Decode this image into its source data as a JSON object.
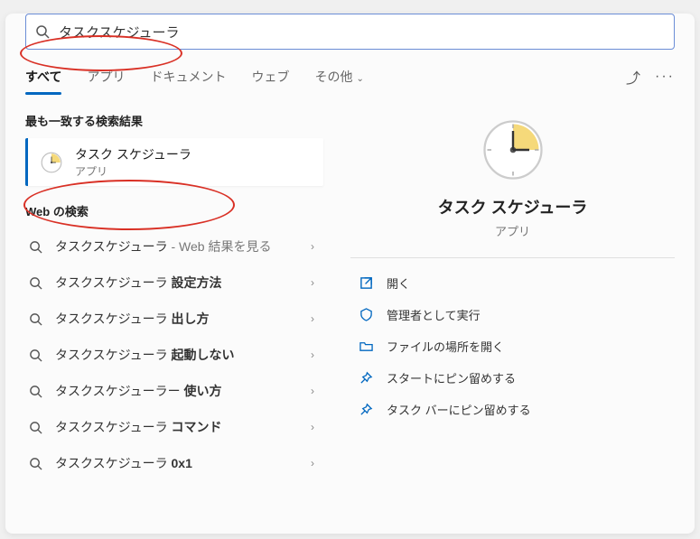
{
  "search": {
    "value": "タスクスケジューラ"
  },
  "tabs": {
    "items": [
      {
        "label": "すべて",
        "active": true
      },
      {
        "label": "アプリ",
        "active": false
      },
      {
        "label": "ドキュメント",
        "active": false
      },
      {
        "label": "ウェブ",
        "active": false
      },
      {
        "label": "その他",
        "active": false,
        "dropdown": true
      }
    ]
  },
  "sections": {
    "best_match_title": "最も一致する検索結果",
    "web_title": "Web の検索"
  },
  "best_match": {
    "title": "タスク スケジューラ",
    "subtitle": "アプリ"
  },
  "web_results": [
    {
      "prefix": "タスクスケジューラ",
      "keyword": "",
      "suffix": " - Web 結果を見る"
    },
    {
      "prefix": "タスクスケジューラ ",
      "keyword": "設定方法",
      "suffix": ""
    },
    {
      "prefix": "タスクスケジューラ ",
      "keyword": "出し方",
      "suffix": ""
    },
    {
      "prefix": "タスクスケジューラ ",
      "keyword": "起動しない",
      "suffix": ""
    },
    {
      "prefix": "タスクスケジューラー ",
      "keyword": "使い方",
      "suffix": ""
    },
    {
      "prefix": "タスクスケジューラ ",
      "keyword": "コマンド",
      "suffix": ""
    },
    {
      "prefix": "タスクスケジューラ ",
      "keyword": "0x1",
      "suffix": ""
    }
  ],
  "detail": {
    "title": "タスク スケジューラ",
    "subtitle": "アプリ",
    "actions": [
      {
        "icon": "open",
        "label": "開く"
      },
      {
        "icon": "admin",
        "label": "管理者として実行"
      },
      {
        "icon": "folder",
        "label": "ファイルの場所を開く"
      },
      {
        "icon": "pin",
        "label": "スタートにピン留めする"
      },
      {
        "icon": "pin",
        "label": "タスク バーにピン留めする"
      }
    ]
  }
}
